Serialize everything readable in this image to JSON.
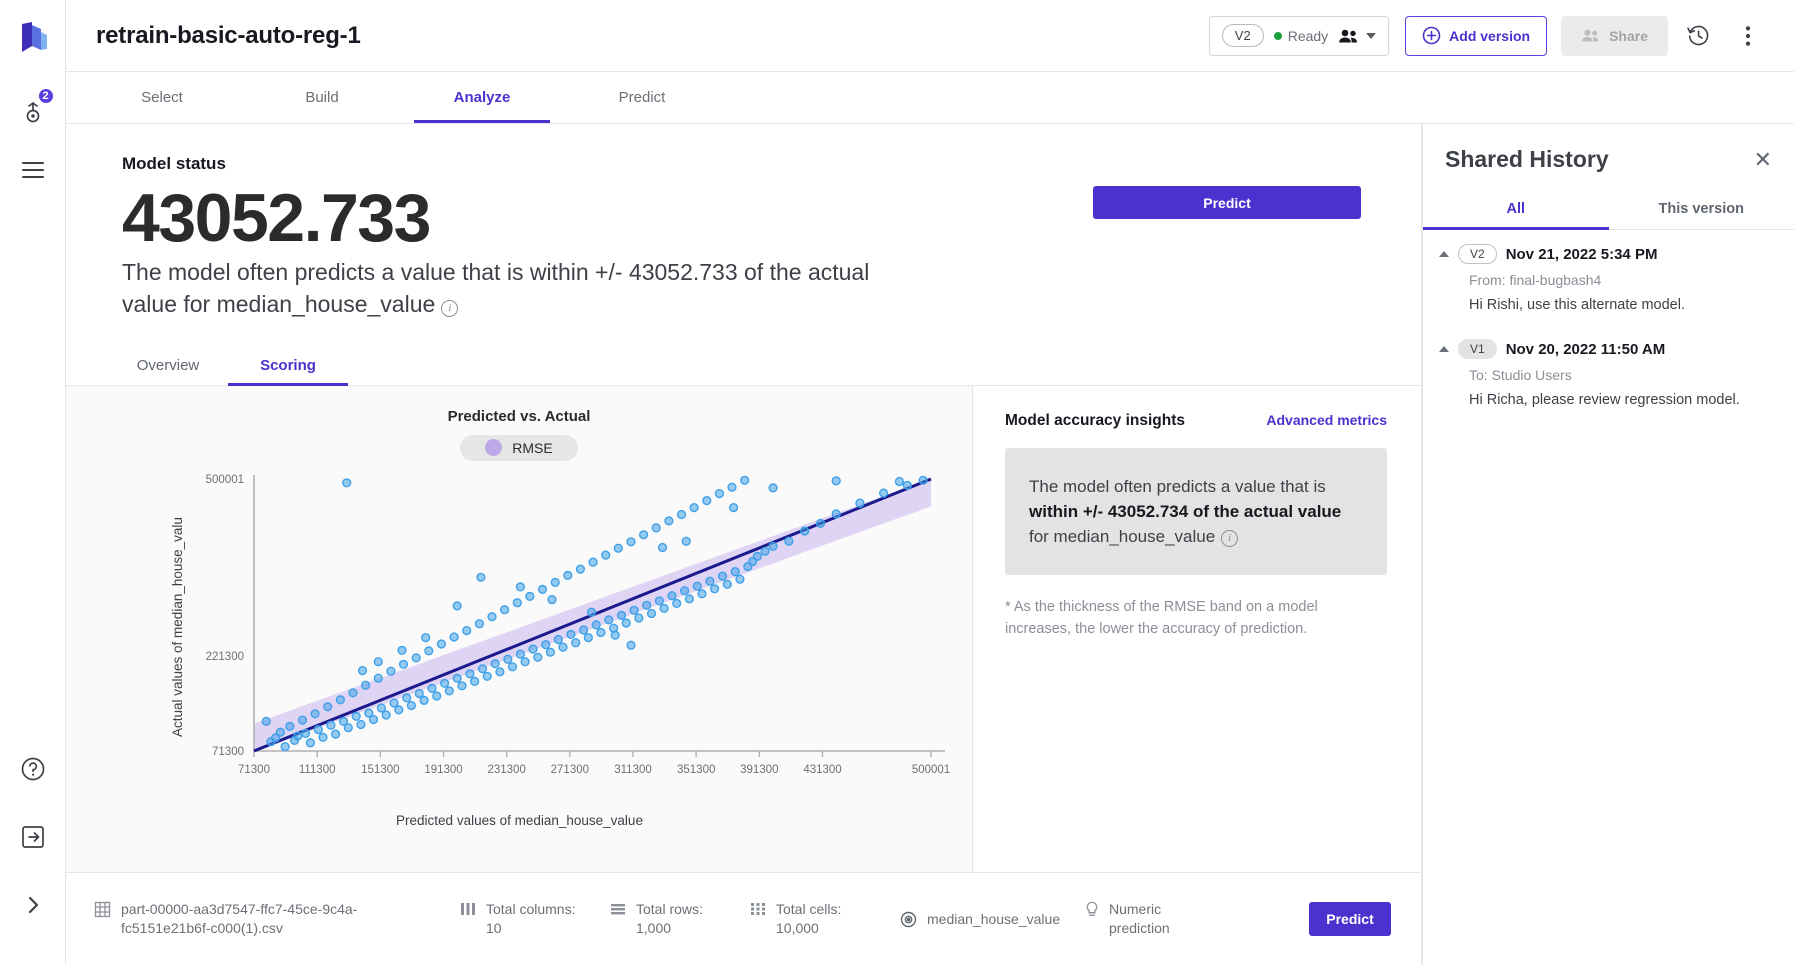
{
  "rail": {
    "logo_icon": "studio-logo-icon",
    "items": [
      {
        "icon": "model-training-icon",
        "badge": "2"
      },
      {
        "icon": "list-icon",
        "badge": ""
      }
    ],
    "bottom_items": [
      {
        "icon": "help-circle-icon"
      },
      {
        "icon": "logout-icon"
      },
      {
        "icon": "expand-chevron-icon"
      }
    ]
  },
  "header": {
    "title": "retrain-basic-auto-reg-1",
    "version_pill": "V2",
    "status": "Ready",
    "people_icon": "people-icon",
    "caret_icon": "chevron-down-icon",
    "add_version_label": "Add version",
    "add_version_icon": "plus-circle-icon",
    "share_label": "Share",
    "share_icon": "share-people-icon",
    "history_icon": "history-clock-icon",
    "more_icon": "more-vertical-icon"
  },
  "tabs": [
    {
      "label": "Select",
      "active": false
    },
    {
      "label": "Build",
      "active": false
    },
    {
      "label": "Analyze",
      "active": true
    },
    {
      "label": "Predict",
      "active": false
    }
  ],
  "status": {
    "label": "Model status",
    "value": "43052.733",
    "description": "The model often predicts a value that is within +/- 43052.733 of the actual value for median_house_value",
    "info_icon": "info-icon",
    "predict_label": "Predict"
  },
  "subtabs": [
    {
      "label": "Overview",
      "active": false
    },
    {
      "label": "Scoring",
      "active": true
    }
  ],
  "chart_data": {
    "type": "scatter",
    "title": "Predicted vs. Actual",
    "xlabel": "Predicted values of median_house_value",
    "ylabel": "Actual values of median_house_valu",
    "legend": [
      {
        "label": "RMSE",
        "color": "#bda9e8"
      }
    ],
    "legend_position": "top-center",
    "grid": false,
    "xlim": [
      71300,
      500001
    ],
    "ylim": [
      71300,
      500001
    ],
    "xticks": [
      71300,
      111300,
      151300,
      191300,
      231300,
      271300,
      311300,
      351300,
      391300,
      431300,
      500001
    ],
    "xtick_labels": [
      "71300",
      "111300",
      "151300",
      "191300",
      "231300",
      "271300",
      "311300",
      "351300",
      "391300",
      "431300",
      "500001"
    ],
    "yticks": [
      71300,
      221300,
      500001
    ],
    "ytick_labels": [
      "71300",
      "221300",
      "500001"
    ],
    "fit_line": {
      "color": "#1a1a8c",
      "from": [
        71300,
        71300
      ],
      "to": [
        500001,
        500001
      ]
    },
    "rmse_band": {
      "color": "#d9cdf2",
      "half_width": 43052.733
    },
    "point_color": "#3fa0e8",
    "points": [
      [
        79000,
        118000
      ],
      [
        82000,
        86000
      ],
      [
        85000,
        92000
      ],
      [
        88000,
        101000
      ],
      [
        91000,
        78000
      ],
      [
        94000,
        110000
      ],
      [
        97000,
        88000
      ],
      [
        99000,
        95000
      ],
      [
        102000,
        120000
      ],
      [
        104000,
        99000
      ],
      [
        107000,
        84000
      ],
      [
        110000,
        130000
      ],
      [
        112000,
        105000
      ],
      [
        115000,
        93000
      ],
      [
        118000,
        141000
      ],
      [
        120000,
        112000
      ],
      [
        123000,
        98000
      ],
      [
        126000,
        152000
      ],
      [
        128000,
        118000
      ],
      [
        131000,
        108000
      ],
      [
        134000,
        163000
      ],
      [
        136000,
        126000
      ],
      [
        139000,
        113000
      ],
      [
        142000,
        175000
      ],
      [
        144000,
        131000
      ],
      [
        147000,
        121000
      ],
      [
        150000,
        186000
      ],
      [
        152000,
        139000
      ],
      [
        155000,
        128000
      ],
      [
        158000,
        197000
      ],
      [
        160000,
        147000
      ],
      [
        163000,
        136000
      ],
      [
        166000,
        208000
      ],
      [
        168000,
        155000
      ],
      [
        171000,
        143000
      ],
      [
        174000,
        218000
      ],
      [
        176000,
        162000
      ],
      [
        179000,
        151000
      ],
      [
        182000,
        229000
      ],
      [
        184000,
        170000
      ],
      [
        187000,
        158000
      ],
      [
        190000,
        240000
      ],
      [
        192000,
        178000
      ],
      [
        195000,
        166000
      ],
      [
        198000,
        251000
      ],
      [
        200000,
        186000
      ],
      [
        203000,
        174000
      ],
      [
        206000,
        261000
      ],
      [
        208000,
        193000
      ],
      [
        211000,
        181000
      ],
      [
        214000,
        272000
      ],
      [
        216000,
        201000
      ],
      [
        219000,
        189000
      ],
      [
        222000,
        283000
      ],
      [
        224000,
        209000
      ],
      [
        227000,
        196000
      ],
      [
        230000,
        294000
      ],
      [
        232000,
        216000
      ],
      [
        235000,
        204000
      ],
      [
        238000,
        305000
      ],
      [
        240000,
        224000
      ],
      [
        243000,
        212000
      ],
      [
        246000,
        315000
      ],
      [
        248000,
        232000
      ],
      [
        251000,
        219000
      ],
      [
        254000,
        326000
      ],
      [
        256000,
        239000
      ],
      [
        259000,
        227000
      ],
      [
        262000,
        337000
      ],
      [
        264000,
        247000
      ],
      [
        267000,
        235000
      ],
      [
        270000,
        348000
      ],
      [
        272000,
        255000
      ],
      [
        275000,
        242000
      ],
      [
        278000,
        358000
      ],
      [
        280000,
        262000
      ],
      [
        283000,
        250000
      ],
      [
        286000,
        369000
      ],
      [
        288000,
        270000
      ],
      [
        291000,
        258000
      ],
      [
        294000,
        380000
      ],
      [
        296000,
        278000
      ],
      [
        299000,
        265000
      ],
      [
        302000,
        391000
      ],
      [
        304000,
        285000
      ],
      [
        307000,
        273000
      ],
      [
        310000,
        401000
      ],
      [
        312000,
        293000
      ],
      [
        315000,
        281000
      ],
      [
        318000,
        412000
      ],
      [
        320000,
        301000
      ],
      [
        323000,
        288000
      ],
      [
        326000,
        423000
      ],
      [
        328000,
        308000
      ],
      [
        331000,
        296000
      ],
      [
        334000,
        434000
      ],
      [
        336000,
        316000
      ],
      [
        339000,
        304000
      ],
      [
        342000,
        444000
      ],
      [
        344000,
        324000
      ],
      [
        347000,
        311000
      ],
      [
        350000,
        455000
      ],
      [
        352000,
        331000
      ],
      [
        355000,
        319000
      ],
      [
        358000,
        466000
      ],
      [
        360000,
        339000
      ],
      [
        363000,
        327000
      ],
      [
        366000,
        477000
      ],
      [
        368000,
        347000
      ],
      [
        371000,
        334000
      ],
      [
        374000,
        487000
      ],
      [
        376000,
        354000
      ],
      [
        379000,
        342000
      ],
      [
        382000,
        498000
      ],
      [
        384000,
        362000
      ],
      [
        387000,
        370000
      ],
      [
        390000,
        378000
      ],
      [
        395000,
        386000
      ],
      [
        400000,
        394000
      ],
      [
        410000,
        402000
      ],
      [
        420000,
        418000
      ],
      [
        430000,
        430000
      ],
      [
        440000,
        445000
      ],
      [
        455000,
        462000
      ],
      [
        470000,
        478000
      ],
      [
        485000,
        490000
      ],
      [
        495000,
        498000
      ],
      [
        130000,
        494000
      ],
      [
        330000,
        392000
      ],
      [
        345000,
        402000
      ],
      [
        375000,
        455000
      ],
      [
        400000,
        486000
      ],
      [
        440000,
        497000
      ],
      [
        480000,
        496000
      ],
      [
        300000,
        254000
      ],
      [
        310000,
        238000
      ],
      [
        285000,
        290000
      ],
      [
        260000,
        310000
      ],
      [
        240000,
        330000
      ],
      [
        215000,
        345000
      ],
      [
        200000,
        300000
      ],
      [
        180000,
        250000
      ],
      [
        165000,
        230000
      ],
      [
        150000,
        212000
      ],
      [
        140000,
        198000
      ]
    ]
  },
  "insights": {
    "title": "Model accuracy insights",
    "advanced_metrics": "Advanced metrics",
    "box_text_pre": "The model often predicts a value that is ",
    "box_text_bold": "within +/- 43052.734 of the actual value",
    "box_text_post": " for median_house_value",
    "info_icon": "info-icon",
    "note": "* As the thickness of the RMSE band on a model increases, the lower the accuracy of prediction."
  },
  "bottombar": {
    "file_icon": "table-file-icon",
    "file_name": "part-00000-aa3d7547-ffc7-45ce-9c4a-fc5151e21b6f-c000(1).csv",
    "columns_icon": "columns-icon",
    "columns_label": "Total columns:",
    "columns_value": "10",
    "rows_icon": "rows-icon",
    "rows_label": "Total rows:",
    "rows_value": "1,000",
    "cells_icon": "cells-icon",
    "cells_label": "Total cells:",
    "cells_value": "10,000",
    "target_icon": "target-icon",
    "target_value": "median_house_value",
    "type_icon": "bulb-icon",
    "type_value": "Numeric prediction",
    "predict_label": "Predict"
  },
  "history": {
    "title": "Shared History",
    "close_icon": "close-icon",
    "tabs": [
      {
        "label": "All",
        "active": true
      },
      {
        "label": "This version",
        "active": false
      }
    ],
    "entries": [
      {
        "version": "V2",
        "date": "Nov 21, 2022 5:34 PM",
        "meta": "From: final-bugbash4",
        "message": "Hi Rishi, use this alternate model."
      },
      {
        "version": "V1",
        "date": "Nov 20, 2022 11:50 AM",
        "meta": "To: Studio Users",
        "message": "Hi Richa, please review regression model."
      }
    ]
  },
  "colors": {
    "accent": "#4b32cf",
    "band": "#d9cdf2",
    "line": "#1a1a8c",
    "point": "#3fa0e8",
    "ready": "#1d9e3d"
  }
}
